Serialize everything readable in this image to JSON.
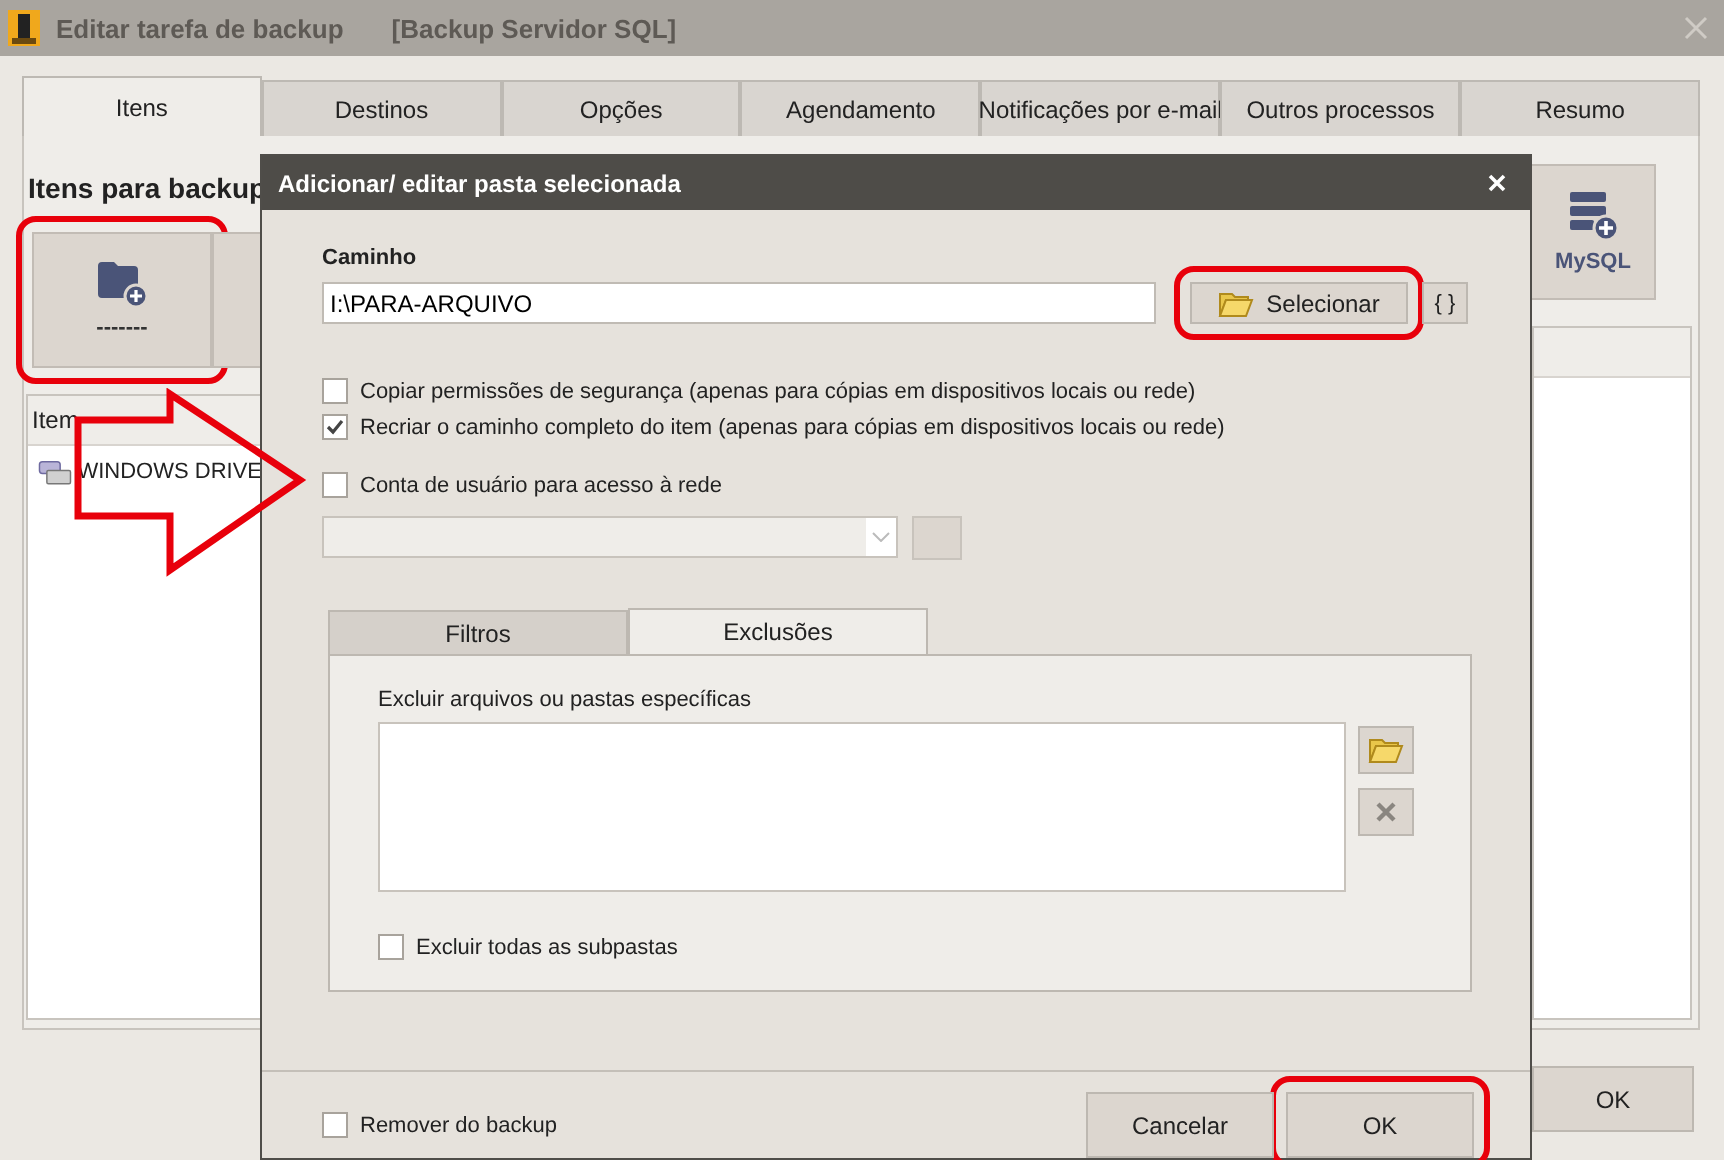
{
  "window": {
    "title": "Editar tarefa de backup",
    "subtitle": "[Backup Servidor SQL]"
  },
  "tabs": [
    {
      "label": "Itens",
      "selected": true
    },
    {
      "label": "Destinos",
      "selected": false
    },
    {
      "label": "Opções",
      "selected": false
    },
    {
      "label": "Agendamento",
      "selected": false
    },
    {
      "label": "Notificações por e-mail",
      "selected": false
    },
    {
      "label": "Outros processos",
      "selected": false
    },
    {
      "label": "Resumo",
      "selected": false
    }
  ],
  "items_panel": {
    "heading": "Itens para backup",
    "toolbar": [
      {
        "kind": "folder",
        "label": "-------",
        "highlighted": true
      },
      {
        "kind": "blank",
        "highlighted": false
      },
      {
        "kind": "mysql",
        "label": "MySQL",
        "highlighted": false
      }
    ],
    "list": {
      "column_1": "Item",
      "rows": [
        {
          "label": "WINDOWS DRIVE"
        }
      ]
    }
  },
  "ok_button": {
    "label": "OK"
  },
  "annotation": {
    "kind": "arrow"
  },
  "dialog": {
    "title": "Adicionar/ editar pasta selecionada",
    "path_label": "Caminho",
    "path": {
      "value": "I:\\PARA-ARQUIVO"
    },
    "select_button": {
      "label": "Selecionar",
      "highlighted": true
    },
    "variables_button": {
      "label": "{ }"
    },
    "options": [
      {
        "label": "Copiar permissões de segurança (apenas para cópias em dispositivos locais ou rede)",
        "checked": false
      },
      {
        "label": "Recriar o caminho completo do item (apenas para cópias em dispositivos locais ou rede)",
        "checked": true
      },
      {
        "label": "Conta de usuário para acesso à rede",
        "checked": false
      }
    ],
    "account": {
      "disabled": true
    },
    "subtabs": [
      {
        "label": "Filtros",
        "selected": false
      },
      {
        "label": "Exclusões",
        "selected": true
      }
    ],
    "exclusions": {
      "label": "Excluir arquivos ou pastas específicas",
      "subfolders": {
        "label": "Excluir todas as subpastas",
        "checked": false
      }
    },
    "remove": {
      "label": "Remover do backup",
      "checked": false
    },
    "buttons": [
      {
        "label": "Cancelar",
        "highlighted": false
      },
      {
        "label": "OK",
        "highlighted": true
      }
    ]
  }
}
